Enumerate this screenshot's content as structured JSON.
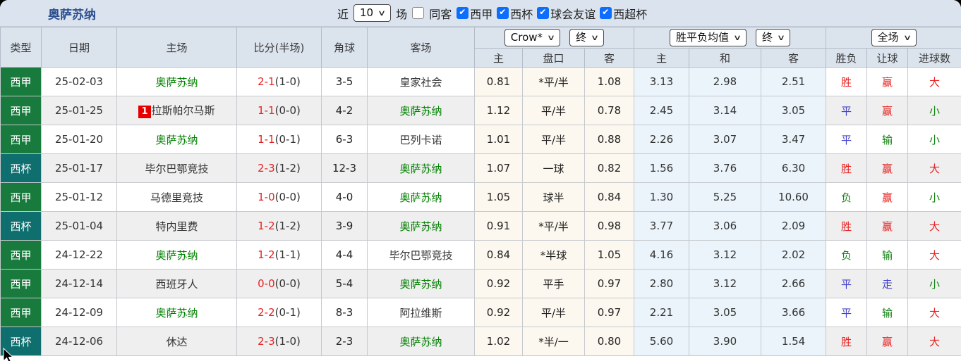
{
  "colors": {
    "title_blue": "#2d4f8e",
    "liga_badge_green": "#187a3d",
    "copa_badge_teal": "#0f6e6e",
    "focus_team_green": "#008000",
    "score_red": "#e62222",
    "handicap_blue": "#4343cc",
    "avg_draw_blue": "#3b6fbe",
    "result_green": "#128212",
    "checkbox_blue": "#0d6efd",
    "rank_badge_red": "#e60000"
  },
  "topbar": {
    "title": "奥萨苏纳",
    "recent_label": "近",
    "recent_count": "10",
    "matches_label": "场",
    "same_away_label": "同客",
    "filters": [
      {
        "label": "西甲",
        "checked": true
      },
      {
        "label": "西杯",
        "checked": true
      },
      {
        "label": "球会友谊",
        "checked": true
      },
      {
        "label": "西超杯",
        "checked": true
      }
    ]
  },
  "header": {
    "group_cols": [
      "类型",
      "日期",
      "主场",
      "比分(半场)",
      "角球",
      "客场"
    ],
    "odds_source_select": "Crow*",
    "odds_final_select": "终",
    "avg_select": "胜平负均值",
    "avg_final_select": "终",
    "scope_select": "全场",
    "sub_cols": [
      "主",
      "盘口",
      "客",
      "主",
      "和",
      "客",
      "胜负",
      "让球",
      "进球数"
    ]
  },
  "rows": [
    {
      "league": "西甲",
      "league_key": "liga",
      "date": "25-02-03",
      "home": "奥萨苏纳",
      "home_is_focus": true,
      "home_rank": null,
      "score": "2-1",
      "half": "(1-0)",
      "corners": "3-5",
      "away": "皇家社会",
      "away_is_focus": false,
      "odds_home": "0.81",
      "handicap": "*平/半",
      "handicap_star": true,
      "odds_away": "1.08",
      "avg_home": "3.13",
      "avg_draw": "2.98",
      "avg_away": "2.51",
      "outcome": {
        "text": "胜",
        "color": "red"
      },
      "handicap_outcome": {
        "text": "赢",
        "color": "red"
      },
      "goals_outcome": {
        "text": "大",
        "color": "red"
      }
    },
    {
      "league": "西甲",
      "league_key": "liga",
      "date": "25-01-25",
      "home": "拉斯帕尔马斯",
      "home_is_focus": false,
      "home_rank": "1",
      "score": "1-1",
      "half": "(0-0)",
      "corners": "4-2",
      "away": "奥萨苏纳",
      "away_is_focus": true,
      "odds_home": "1.12",
      "handicap": "平/半",
      "handicap_star": false,
      "odds_away": "0.78",
      "avg_home": "2.45",
      "avg_draw": "3.14",
      "avg_away": "3.05",
      "outcome": {
        "text": "平",
        "color": "blue"
      },
      "handicap_outcome": {
        "text": "赢",
        "color": "red"
      },
      "goals_outcome": {
        "text": "小",
        "color": "green"
      }
    },
    {
      "league": "西甲",
      "league_key": "liga",
      "date": "25-01-20",
      "home": "奥萨苏纳",
      "home_is_focus": true,
      "home_rank": null,
      "score": "1-1",
      "half": "(0-1)",
      "corners": "6-3",
      "away": "巴列卡诺",
      "away_is_focus": false,
      "odds_home": "1.01",
      "handicap": "平/半",
      "handicap_star": false,
      "odds_away": "0.88",
      "avg_home": "2.26",
      "avg_draw": "3.07",
      "avg_away": "3.47",
      "outcome": {
        "text": "平",
        "color": "blue"
      },
      "handicap_outcome": {
        "text": "输",
        "color": "green"
      },
      "goals_outcome": {
        "text": "小",
        "color": "green"
      }
    },
    {
      "league": "西杯",
      "league_key": "copa",
      "date": "25-01-17",
      "home": "毕尔巴鄂竞技",
      "home_is_focus": false,
      "home_rank": null,
      "score": "2-3",
      "half": "(1-2)",
      "corners": "12-3",
      "away": "奥萨苏纳",
      "away_is_focus": true,
      "odds_home": "1.07",
      "handicap": "一球",
      "handicap_star": false,
      "odds_away": "0.82",
      "avg_home": "1.56",
      "avg_draw": "3.76",
      "avg_away": "6.30",
      "outcome": {
        "text": "胜",
        "color": "red"
      },
      "handicap_outcome": {
        "text": "赢",
        "color": "red"
      },
      "goals_outcome": {
        "text": "大",
        "color": "red"
      }
    },
    {
      "league": "西甲",
      "league_key": "liga",
      "date": "25-01-12",
      "home": "马德里竞技",
      "home_is_focus": false,
      "home_rank": null,
      "score": "1-0",
      "half": "(0-0)",
      "corners": "4-0",
      "away": "奥萨苏纳",
      "away_is_focus": true,
      "odds_home": "1.05",
      "handicap": "球半",
      "handicap_star": false,
      "odds_away": "0.84",
      "avg_home": "1.30",
      "avg_draw": "5.25",
      "avg_away": "10.60",
      "outcome": {
        "text": "负",
        "color": "green"
      },
      "handicap_outcome": {
        "text": "赢",
        "color": "red"
      },
      "goals_outcome": {
        "text": "小",
        "color": "green"
      }
    },
    {
      "league": "西杯",
      "league_key": "copa",
      "date": "25-01-04",
      "home": "特内里费",
      "home_is_focus": false,
      "home_rank": null,
      "score": "1-2",
      "half": "(1-2)",
      "corners": "3-9",
      "away": "奥萨苏纳",
      "away_is_focus": true,
      "odds_home": "0.91",
      "handicap": "*平/半",
      "handicap_star": true,
      "odds_away": "0.98",
      "avg_home": "3.77",
      "avg_draw": "3.06",
      "avg_away": "2.09",
      "outcome": {
        "text": "胜",
        "color": "red"
      },
      "handicap_outcome": {
        "text": "赢",
        "color": "red"
      },
      "goals_outcome": {
        "text": "大",
        "color": "red"
      }
    },
    {
      "league": "西甲",
      "league_key": "liga",
      "date": "24-12-22",
      "home": "奥萨苏纳",
      "home_is_focus": true,
      "home_rank": null,
      "score": "1-2",
      "half": "(1-1)",
      "corners": "4-4",
      "away": "毕尔巴鄂竞技",
      "away_is_focus": false,
      "odds_home": "0.84",
      "handicap": "*半球",
      "handicap_star": true,
      "odds_away": "1.05",
      "avg_home": "4.16",
      "avg_draw": "3.12",
      "avg_away": "2.02",
      "outcome": {
        "text": "负",
        "color": "green"
      },
      "handicap_outcome": {
        "text": "输",
        "color": "green"
      },
      "goals_outcome": {
        "text": "大",
        "color": "red"
      }
    },
    {
      "league": "西甲",
      "league_key": "liga",
      "date": "24-12-14",
      "home": "西班牙人",
      "home_is_focus": false,
      "home_rank": null,
      "score": "0-0",
      "half": "(0-0)",
      "corners": "5-4",
      "away": "奥萨苏纳",
      "away_is_focus": true,
      "odds_home": "0.92",
      "handicap": "平手",
      "handicap_star": false,
      "odds_away": "0.97",
      "avg_home": "2.80",
      "avg_draw": "3.12",
      "avg_away": "2.66",
      "outcome": {
        "text": "平",
        "color": "blue"
      },
      "handicap_outcome": {
        "text": "走",
        "color": "blue"
      },
      "goals_outcome": {
        "text": "小",
        "color": "green"
      }
    },
    {
      "league": "西甲",
      "league_key": "liga",
      "date": "24-12-09",
      "home": "奥萨苏纳",
      "home_is_focus": true,
      "home_rank": null,
      "score": "2-2",
      "half": "(0-1)",
      "corners": "8-3",
      "away": "阿拉维斯",
      "away_is_focus": false,
      "odds_home": "0.92",
      "handicap": "平/半",
      "handicap_star": false,
      "odds_away": "0.97",
      "avg_home": "2.21",
      "avg_draw": "3.05",
      "avg_away": "3.66",
      "outcome": {
        "text": "平",
        "color": "blue"
      },
      "handicap_outcome": {
        "text": "输",
        "color": "green"
      },
      "goals_outcome": {
        "text": "大",
        "color": "red"
      }
    },
    {
      "league": "西杯",
      "league_key": "copa",
      "date": "24-12-06",
      "home": "休达",
      "home_is_focus": false,
      "home_rank": null,
      "score": "2-3",
      "half": "(1-0)",
      "corners": "2-3",
      "away": "奥萨苏纳",
      "away_is_focus": true,
      "odds_home": "1.02",
      "handicap": "*半/一",
      "handicap_star": true,
      "odds_away": "0.80",
      "avg_home": "5.60",
      "avg_draw": "3.90",
      "avg_away": "1.54",
      "outcome": {
        "text": "胜",
        "color": "red"
      },
      "handicap_outcome": {
        "text": "赢",
        "color": "red"
      },
      "goals_outcome": {
        "text": "大",
        "color": "red"
      }
    }
  ]
}
